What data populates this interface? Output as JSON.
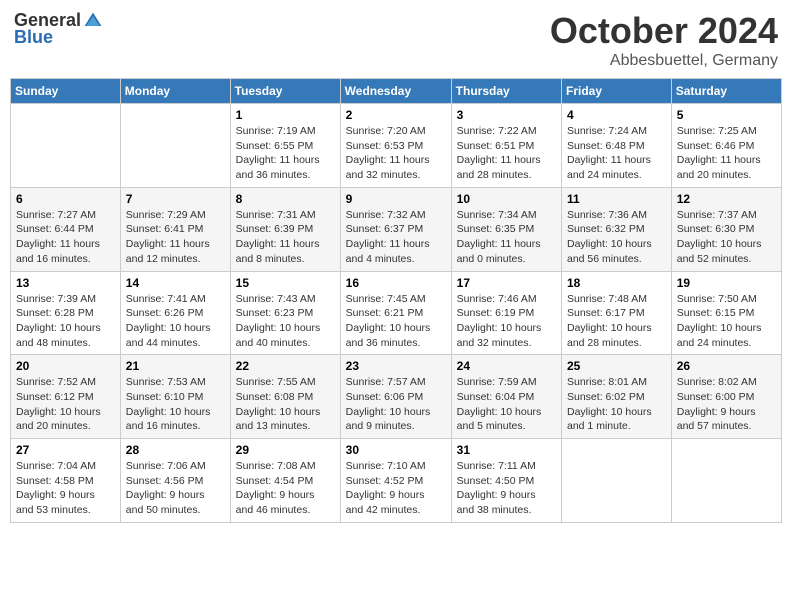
{
  "logo": {
    "general": "General",
    "blue": "Blue"
  },
  "title": {
    "month": "October 2024",
    "subtitle": "Abbesbuettel, Germany"
  },
  "headers": [
    "Sunday",
    "Monday",
    "Tuesday",
    "Wednesday",
    "Thursday",
    "Friday",
    "Saturday"
  ],
  "weeks": [
    [
      {
        "day": "",
        "info": ""
      },
      {
        "day": "",
        "info": ""
      },
      {
        "day": "1",
        "info": "Sunrise: 7:19 AM\nSunset: 6:55 PM\nDaylight: 11 hours\nand 36 minutes."
      },
      {
        "day": "2",
        "info": "Sunrise: 7:20 AM\nSunset: 6:53 PM\nDaylight: 11 hours\nand 32 minutes."
      },
      {
        "day": "3",
        "info": "Sunrise: 7:22 AM\nSunset: 6:51 PM\nDaylight: 11 hours\nand 28 minutes."
      },
      {
        "day": "4",
        "info": "Sunrise: 7:24 AM\nSunset: 6:48 PM\nDaylight: 11 hours\nand 24 minutes."
      },
      {
        "day": "5",
        "info": "Sunrise: 7:25 AM\nSunset: 6:46 PM\nDaylight: 11 hours\nand 20 minutes."
      }
    ],
    [
      {
        "day": "6",
        "info": "Sunrise: 7:27 AM\nSunset: 6:44 PM\nDaylight: 11 hours\nand 16 minutes."
      },
      {
        "day": "7",
        "info": "Sunrise: 7:29 AM\nSunset: 6:41 PM\nDaylight: 11 hours\nand 12 minutes."
      },
      {
        "day": "8",
        "info": "Sunrise: 7:31 AM\nSunset: 6:39 PM\nDaylight: 11 hours\nand 8 minutes."
      },
      {
        "day": "9",
        "info": "Sunrise: 7:32 AM\nSunset: 6:37 PM\nDaylight: 11 hours\nand 4 minutes."
      },
      {
        "day": "10",
        "info": "Sunrise: 7:34 AM\nSunset: 6:35 PM\nDaylight: 11 hours\nand 0 minutes."
      },
      {
        "day": "11",
        "info": "Sunrise: 7:36 AM\nSunset: 6:32 PM\nDaylight: 10 hours\nand 56 minutes."
      },
      {
        "day": "12",
        "info": "Sunrise: 7:37 AM\nSunset: 6:30 PM\nDaylight: 10 hours\nand 52 minutes."
      }
    ],
    [
      {
        "day": "13",
        "info": "Sunrise: 7:39 AM\nSunset: 6:28 PM\nDaylight: 10 hours\nand 48 minutes."
      },
      {
        "day": "14",
        "info": "Sunrise: 7:41 AM\nSunset: 6:26 PM\nDaylight: 10 hours\nand 44 minutes."
      },
      {
        "day": "15",
        "info": "Sunrise: 7:43 AM\nSunset: 6:23 PM\nDaylight: 10 hours\nand 40 minutes."
      },
      {
        "day": "16",
        "info": "Sunrise: 7:45 AM\nSunset: 6:21 PM\nDaylight: 10 hours\nand 36 minutes."
      },
      {
        "day": "17",
        "info": "Sunrise: 7:46 AM\nSunset: 6:19 PM\nDaylight: 10 hours\nand 32 minutes."
      },
      {
        "day": "18",
        "info": "Sunrise: 7:48 AM\nSunset: 6:17 PM\nDaylight: 10 hours\nand 28 minutes."
      },
      {
        "day": "19",
        "info": "Sunrise: 7:50 AM\nSunset: 6:15 PM\nDaylight: 10 hours\nand 24 minutes."
      }
    ],
    [
      {
        "day": "20",
        "info": "Sunrise: 7:52 AM\nSunset: 6:12 PM\nDaylight: 10 hours\nand 20 minutes."
      },
      {
        "day": "21",
        "info": "Sunrise: 7:53 AM\nSunset: 6:10 PM\nDaylight: 10 hours\nand 16 minutes."
      },
      {
        "day": "22",
        "info": "Sunrise: 7:55 AM\nSunset: 6:08 PM\nDaylight: 10 hours\nand 13 minutes."
      },
      {
        "day": "23",
        "info": "Sunrise: 7:57 AM\nSunset: 6:06 PM\nDaylight: 10 hours\nand 9 minutes."
      },
      {
        "day": "24",
        "info": "Sunrise: 7:59 AM\nSunset: 6:04 PM\nDaylight: 10 hours\nand 5 minutes."
      },
      {
        "day": "25",
        "info": "Sunrise: 8:01 AM\nSunset: 6:02 PM\nDaylight: 10 hours\nand 1 minute."
      },
      {
        "day": "26",
        "info": "Sunrise: 8:02 AM\nSunset: 6:00 PM\nDaylight: 9 hours\nand 57 minutes."
      }
    ],
    [
      {
        "day": "27",
        "info": "Sunrise: 7:04 AM\nSunset: 4:58 PM\nDaylight: 9 hours\nand 53 minutes."
      },
      {
        "day": "28",
        "info": "Sunrise: 7:06 AM\nSunset: 4:56 PM\nDaylight: 9 hours\nand 50 minutes."
      },
      {
        "day": "29",
        "info": "Sunrise: 7:08 AM\nSunset: 4:54 PM\nDaylight: 9 hours\nand 46 minutes."
      },
      {
        "day": "30",
        "info": "Sunrise: 7:10 AM\nSunset: 4:52 PM\nDaylight: 9 hours\nand 42 minutes."
      },
      {
        "day": "31",
        "info": "Sunrise: 7:11 AM\nSunset: 4:50 PM\nDaylight: 9 hours\nand 38 minutes."
      },
      {
        "day": "",
        "info": ""
      },
      {
        "day": "",
        "info": ""
      }
    ]
  ]
}
